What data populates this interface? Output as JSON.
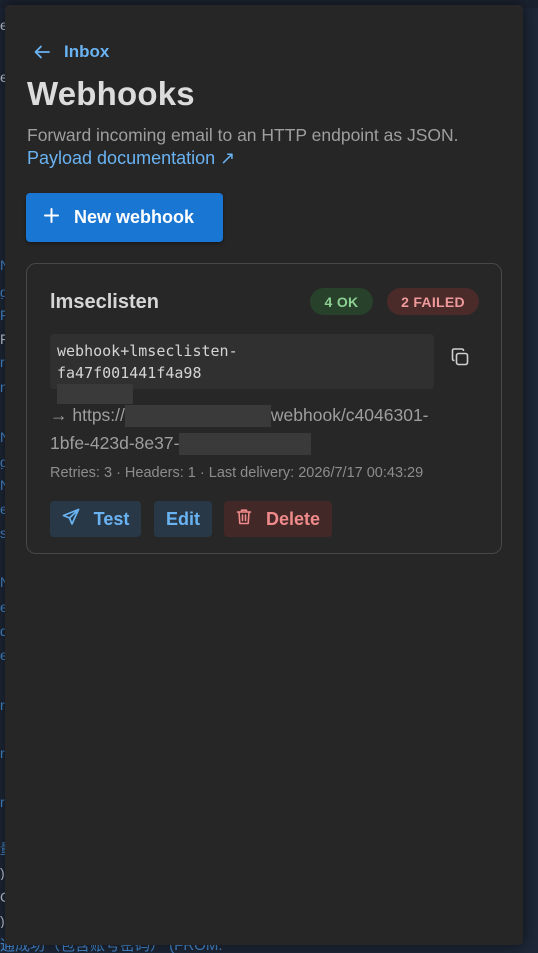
{
  "drawer": {
    "back_label": "Inbox",
    "title": "Webhooks",
    "subtitle": "Forward incoming email to an HTTP endpoint as JSON.",
    "doc_link": "Payload documentation ↗",
    "new_button_label": "New webhook"
  },
  "webhook": {
    "name": "lmseclisten",
    "ok_badge": "4 OK",
    "failed_badge": "2 FAILED",
    "address_line1": "webhook+lmseclisten-",
    "address_line2": "fa47f001441f4a98",
    "endpoint_prefix": "→ https://",
    "endpoint_mid": "webhook/c4046301-",
    "endpoint_line2": "1bfe-423d-8e37-",
    "meta": "Retries: 3 · Headers: 1 · Last delivery: 2026/7/17 00:43:29",
    "actions": {
      "test_label": "Test",
      "edit_label": "Edit",
      "delete_label": "Delete"
    }
  },
  "background": {
    "bottom_text": "通成功（包含账号密码） (FROM:"
  },
  "colors": {
    "accent": "#1976d2",
    "link": "#6ab3f3",
    "ok": "#8ccf92",
    "failed": "#ee9a9a",
    "drawer_bg": "#262626"
  }
}
